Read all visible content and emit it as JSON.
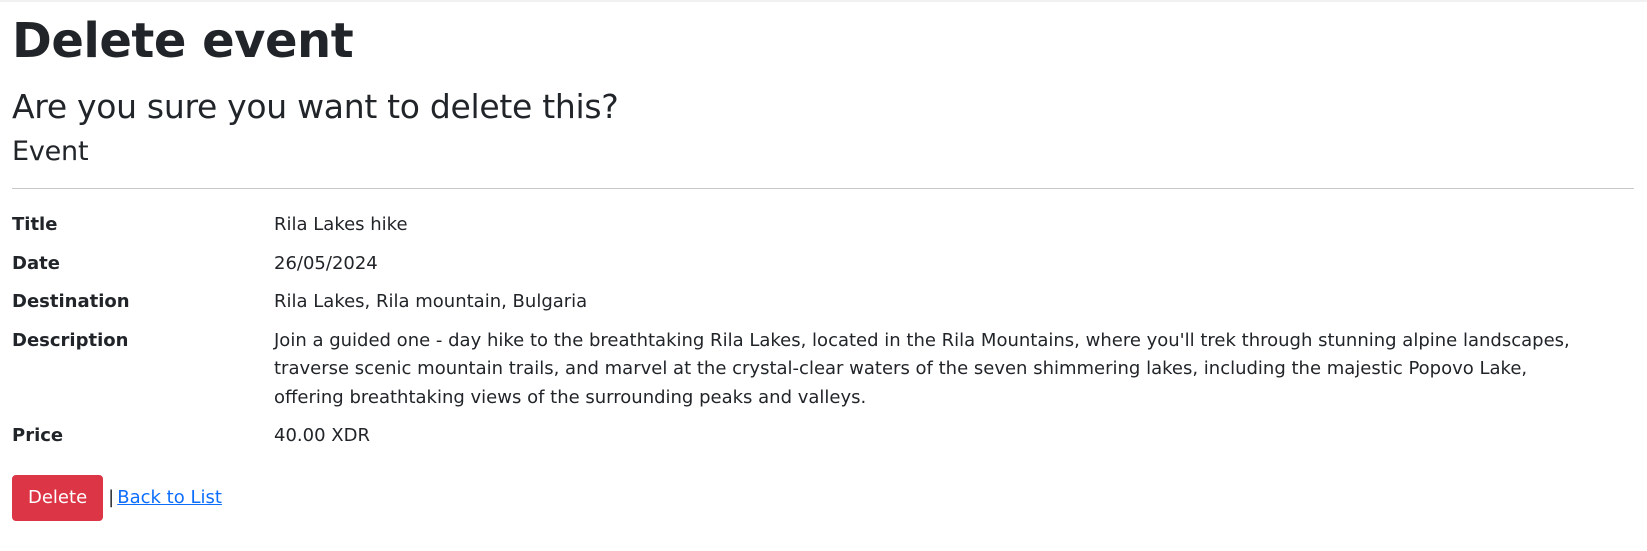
{
  "page": {
    "title": "Delete event",
    "confirm_text": "Are you sure you want to delete this?",
    "entity_heading": "Event"
  },
  "details": [
    {
      "label": "Title",
      "value": "Rila Lakes hike"
    },
    {
      "label": "Date",
      "value": "26/05/2024"
    },
    {
      "label": "Destination",
      "value": "Rila Lakes, Rila mountain, Bulgaria"
    },
    {
      "label": "Description",
      "value": "Join a guided one - day hike to the breathtaking Rila Lakes, located in the Rila Mountains, where you'll trek through stunning alpine landscapes, traverse scenic mountain trails, and marvel at the crystal-clear waters of the seven shimmering lakes, including the majestic Popovo Lake, offering breathtaking views of the surrounding peaks and valleys."
    },
    {
      "label": "Price",
      "value": "40.00 XDR"
    }
  ],
  "actions": {
    "delete_label": "Delete",
    "separator": "|",
    "back_label": "Back to List"
  },
  "colors": {
    "danger": "#dc3545",
    "link": "#0d6efd",
    "text": "#212529"
  }
}
